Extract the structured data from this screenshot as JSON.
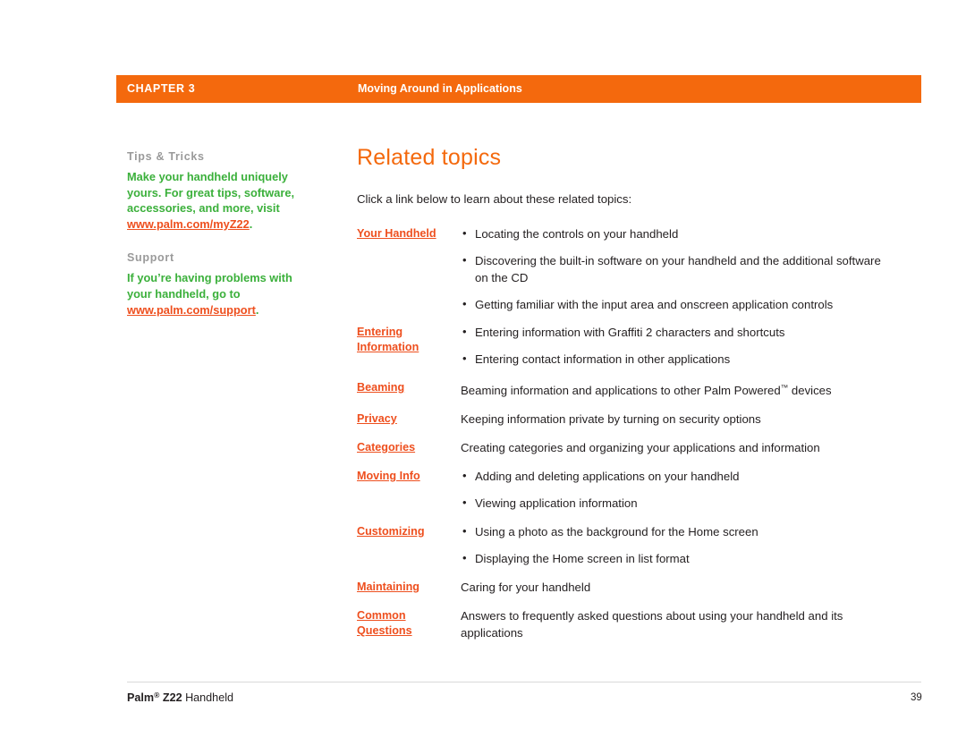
{
  "header": {
    "chapter": "CHAPTER 3",
    "title": "Moving Around in Applications",
    "bar_color": "#f4690d"
  },
  "sidebar": {
    "blocks": [
      {
        "heading": "Tips & Tricks",
        "text_before": "Make your handheld uniquely yours. For great tips, software, accessories, and more, visit ",
        "link": "www.palm.com/myZ22",
        "text_after": "."
      },
      {
        "heading": "Support",
        "text_before": "If you’re having problems with your handheld, go to ",
        "link": "www.palm.com/support",
        "text_after": "."
      }
    ],
    "heading_color": "#9a9a9a",
    "body_color": "#3bb03b",
    "link_color": "#ee4f1e"
  },
  "main": {
    "title": "Related topics",
    "intro": "Click a link below to learn about these related topics:",
    "topics": [
      {
        "link": "Your Handheld",
        "lines": [
          {
            "text": "Locating the controls on your handheld",
            "bullet": true
          },
          {
            "text": "Discovering the built-in software on your handheld and the additional software on the CD",
            "bullet": true
          },
          {
            "text": "Getting familiar with the input area and onscreen application controls",
            "bullet": true
          }
        ]
      },
      {
        "link": "Entering Information",
        "lines": [
          {
            "text": "Entering information with Graffiti 2 characters and shortcuts",
            "bullet": true
          },
          {
            "text": "Entering contact information in other applications",
            "bullet": true
          }
        ]
      },
      {
        "link": "Beaming",
        "lines": [
          {
            "text": "Beaming information and applications to other Palm Powered™ devices",
            "bullet": false
          }
        ]
      },
      {
        "link": "Privacy",
        "lines": [
          {
            "text": "Keeping information private by turning on security options",
            "bullet": false
          }
        ]
      },
      {
        "link": "Categories",
        "lines": [
          {
            "text": "Creating categories and organizing your applications and information",
            "bullet": false
          }
        ]
      },
      {
        "link": "Moving Info",
        "lines": [
          {
            "text": "Adding and deleting applications on your handheld",
            "bullet": true
          },
          {
            "text": "Viewing application information",
            "bullet": true
          }
        ]
      },
      {
        "link": "Customizing",
        "lines": [
          {
            "text": "Using a photo as the background for the Home screen",
            "bullet": true
          },
          {
            "text": "Displaying the Home screen in list format",
            "bullet": true
          }
        ]
      },
      {
        "link": "Maintaining",
        "lines": [
          {
            "text": "Caring for your handheld",
            "bullet": false
          }
        ]
      },
      {
        "link": "Common Questions",
        "lines": [
          {
            "text": "Answers to frequently asked questions about using your handheld and its applications",
            "bullet": false
          }
        ]
      }
    ]
  },
  "footer": {
    "product_brand": "Palm",
    "product_model": "Z22",
    "product_suffix": " Handheld",
    "page_number": "39"
  }
}
